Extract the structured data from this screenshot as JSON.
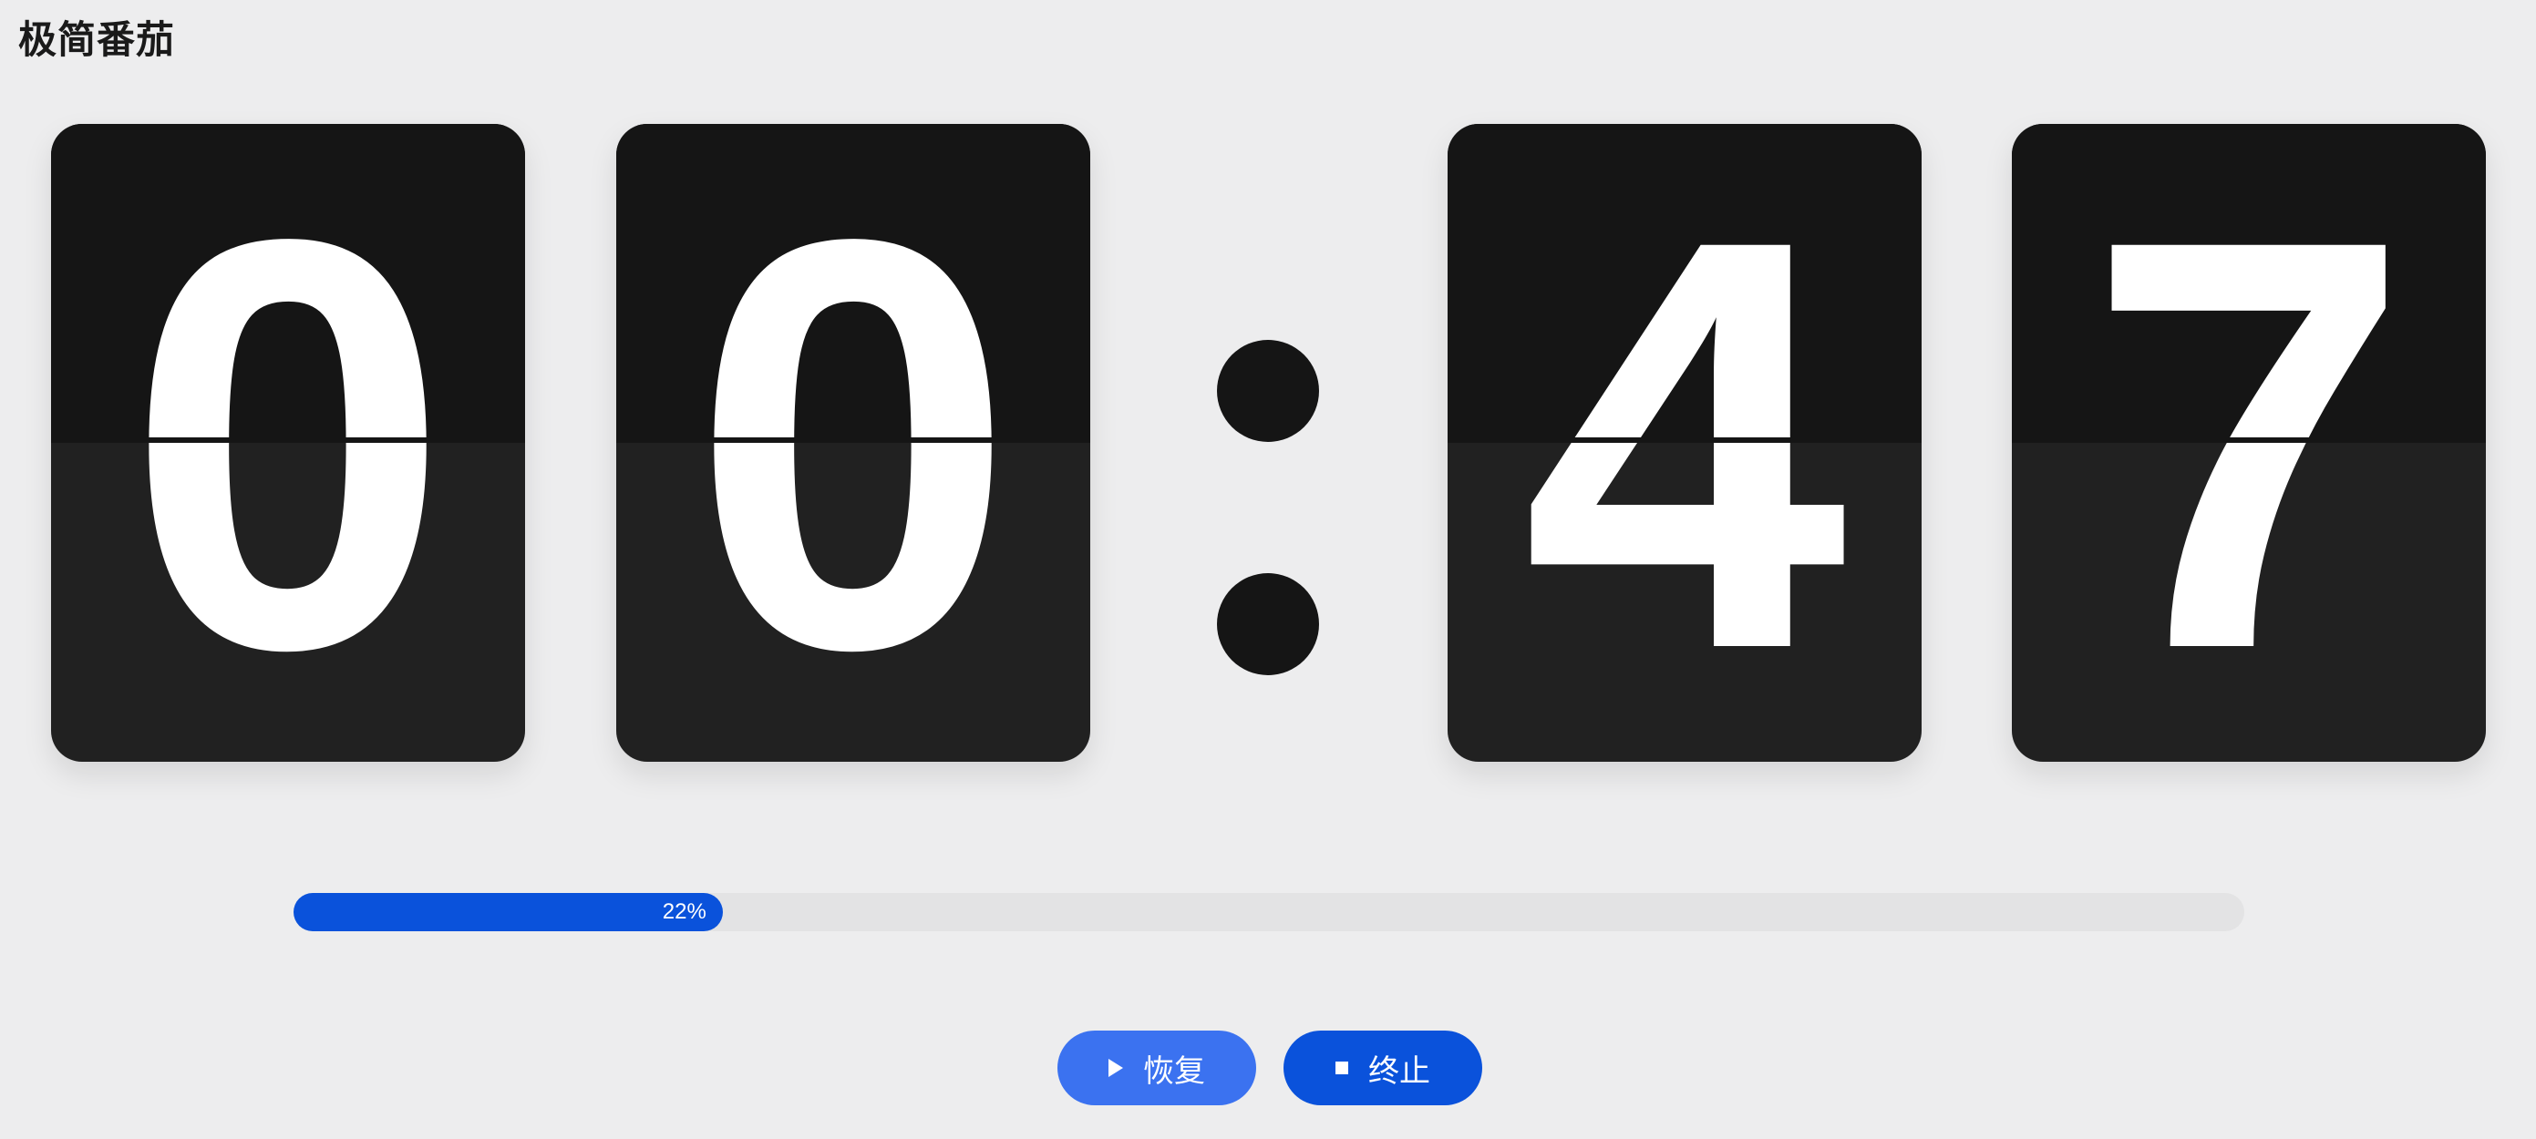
{
  "app": {
    "title": "极简番茄"
  },
  "timer": {
    "digits": [
      "0",
      "0",
      "4",
      "7"
    ],
    "separator": ":"
  },
  "progress": {
    "percent": 22,
    "label": "22%"
  },
  "controls": {
    "resume_label": "恢复",
    "resume_icon": "play-icon",
    "stop_label": "终止",
    "stop_icon": "stop-icon"
  },
  "colors": {
    "background": "#ededee",
    "card_top": "#151515",
    "card_bottom": "#212121",
    "accent": "#0a52db",
    "accent_light": "#3b72f0"
  }
}
